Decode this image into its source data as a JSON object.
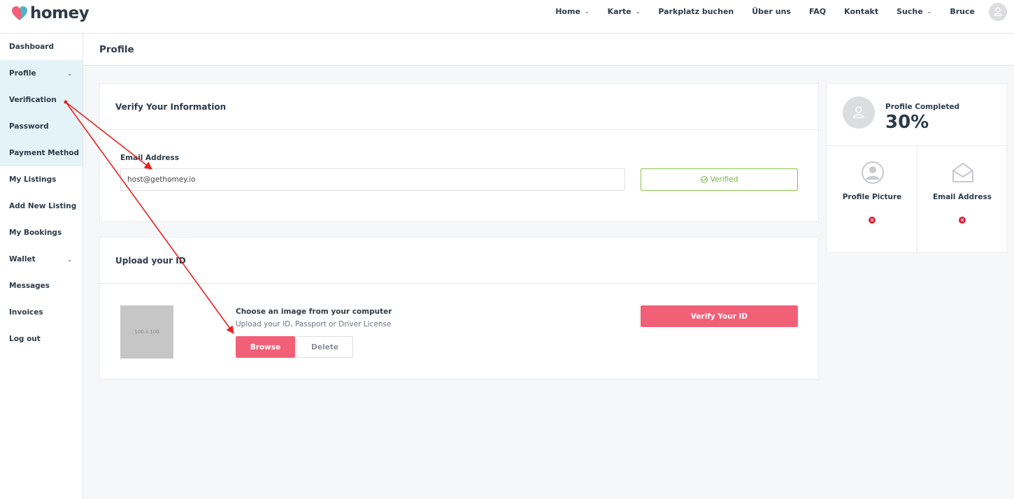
{
  "brand": {
    "name": "homey"
  },
  "nav": {
    "items": [
      {
        "label": "Home",
        "has_dropdown": true
      },
      {
        "label": "Karte",
        "has_dropdown": true
      },
      {
        "label": "Parkplatz buchen",
        "has_dropdown": false
      },
      {
        "label": "Über uns",
        "has_dropdown": false
      },
      {
        "label": "FAQ",
        "has_dropdown": false
      },
      {
        "label": "Kontakt",
        "has_dropdown": false
      },
      {
        "label": "Suche",
        "has_dropdown": true
      },
      {
        "label": "Bruce",
        "has_dropdown": false
      }
    ],
    "avatar_icon": "user-icon"
  },
  "sidebar": {
    "items": [
      {
        "label": "Dashboard",
        "active": false,
        "has_dropdown": false
      },
      {
        "label": "Profile",
        "active": true,
        "has_dropdown": true
      },
      {
        "label": "Verification",
        "active": true,
        "has_dropdown": false
      },
      {
        "label": "Password",
        "active": true,
        "has_dropdown": false
      },
      {
        "label": "Payment Method",
        "active": true,
        "has_dropdown": false
      },
      {
        "label": "My Listings",
        "active": false,
        "has_dropdown": false
      },
      {
        "label": "Add New Listing",
        "active": false,
        "has_dropdown": false
      },
      {
        "label": "My Bookings",
        "active": false,
        "has_dropdown": false
      },
      {
        "label": "Wallet",
        "active": false,
        "has_dropdown": true
      },
      {
        "label": "Messages",
        "active": false,
        "has_dropdown": false
      },
      {
        "label": "Invoices",
        "active": false,
        "has_dropdown": false
      },
      {
        "label": "Log out",
        "active": false,
        "has_dropdown": false
      }
    ]
  },
  "page": {
    "title": "Profile"
  },
  "verify_card": {
    "title": "Verify Your Information",
    "email_label": "Email Address",
    "email_value": "host@gethomey.io",
    "verified_label": "Verified"
  },
  "upload_card": {
    "title": "Upload your ID",
    "placeholder_text": "100 x 100",
    "choose_title": "Choose an image from your computer",
    "choose_sub": "Upload your ID, Passport or Driver License",
    "browse_label": "Browse",
    "delete_label": "Delete",
    "verify_id_label": "Verify Your ID"
  },
  "profile_completed": {
    "label": "Profile Completed",
    "value": "30%",
    "progress": 0.3,
    "items": [
      {
        "label": "Profile Picture",
        "icon": "user-circle-icon",
        "status": "x"
      },
      {
        "label": "Email Address",
        "icon": "envelope-open-icon",
        "status": "x"
      }
    ]
  },
  "colors": {
    "accent": "#f26078",
    "verified": "#7cb342",
    "active_sidebar_bg": "#e4f3f7",
    "annotation_arrow": "#e8201f",
    "incomplete": "#d9233b"
  }
}
